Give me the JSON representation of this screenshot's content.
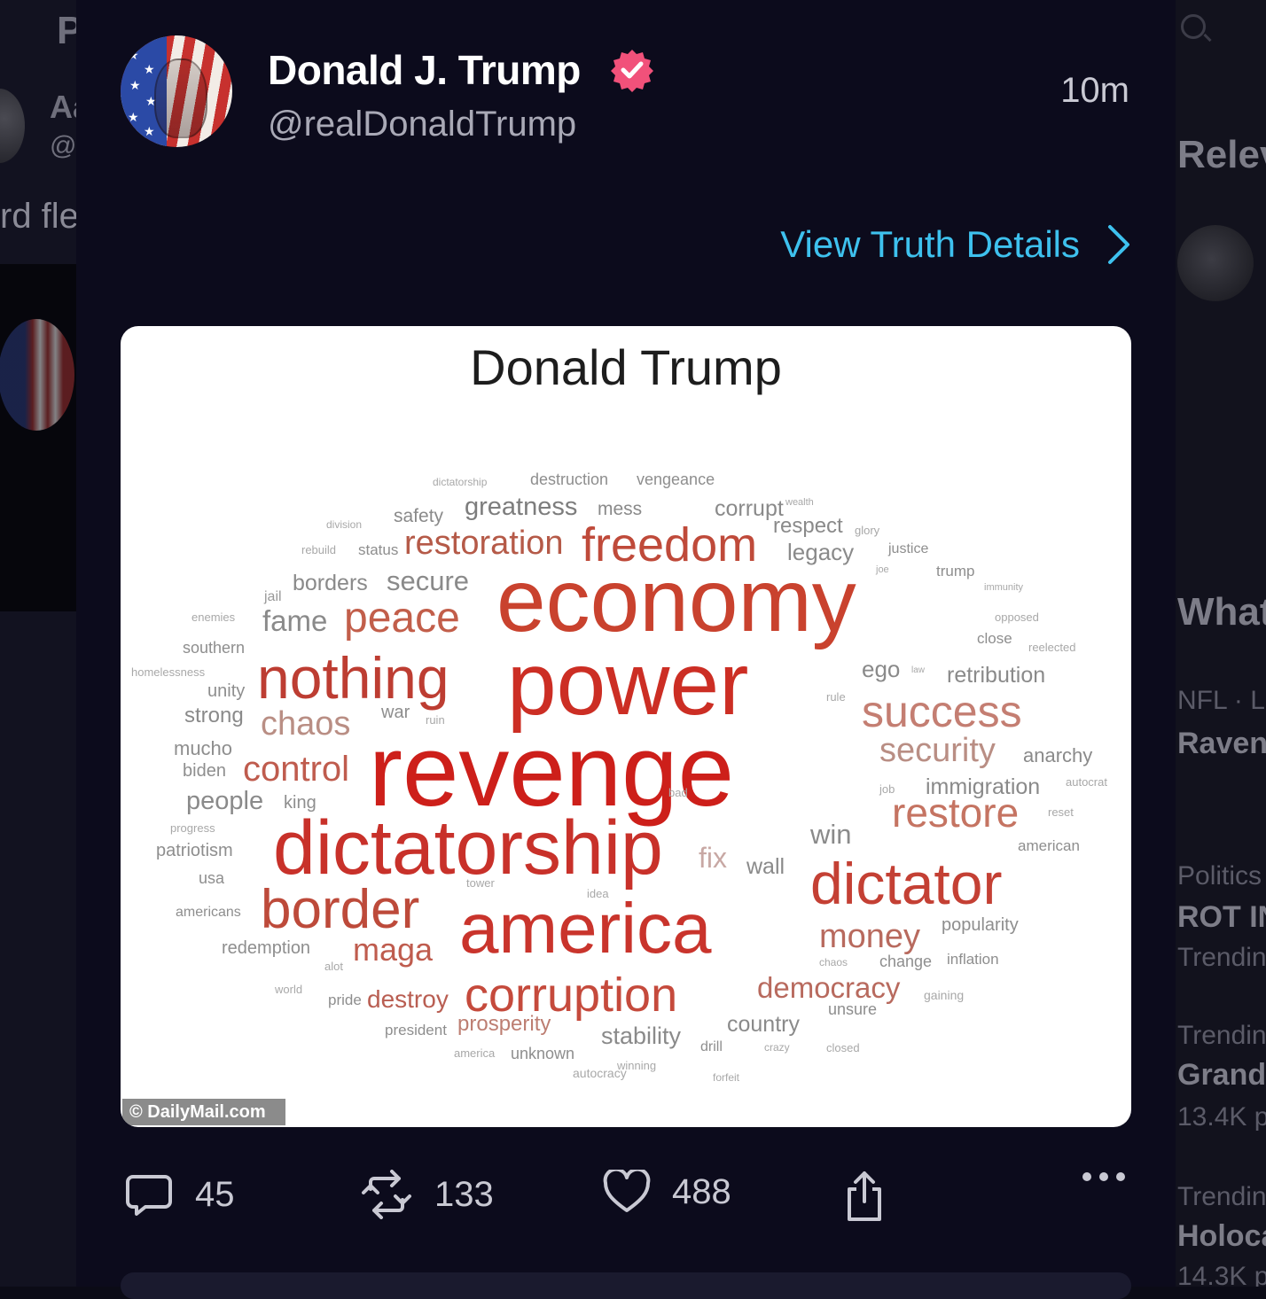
{
  "background_left": {
    "lines": [
      "P",
      "Aa",
      "@",
      "rd fle"
    ]
  },
  "background_right": {
    "items": [
      "Relev",
      "What",
      "NFL · La",
      "Raven",
      "Politics",
      "ROT IN",
      "Trendin",
      "Trendin",
      "Grand",
      "13.4K p",
      "Trendin",
      "Holoca",
      "14.3K p"
    ]
  },
  "post": {
    "author_name": "Donald J. Trump",
    "handle": "@realDonaldTrump",
    "time": "10m",
    "view_details_label": "View Truth Details",
    "verified_icon": "verified-badge-icon",
    "media": {
      "title": "Donald Trump",
      "watermark": "© DailyMail.com",
      "words": [
        "dictatorship",
        "destruction",
        "vengeance",
        "division",
        "safety",
        "greatness",
        "mess",
        "corrupt",
        "wealth",
        "respect",
        "glory",
        "rebuild",
        "status",
        "restoration",
        "freedom",
        "legacy",
        "justice",
        "joe",
        "trump",
        "jail",
        "borders",
        "secure",
        "immunity",
        "enemies",
        "fame",
        "peace",
        "economy",
        "opposed",
        "southern",
        "close",
        "reelected",
        "homelessness",
        "nothing",
        "power",
        "ego",
        "law",
        "retribution",
        "unity",
        "rule",
        "strong",
        "chaos",
        "war",
        "ruin",
        "success",
        "mucho",
        "security",
        "anarchy",
        "biden",
        "control",
        "revenge",
        "job",
        "immigration",
        "autocrat",
        "people",
        "king",
        "bad",
        "restore",
        "reset",
        "progress",
        "win",
        "american",
        "patriotism",
        "fix",
        "dictatorship",
        "usa",
        "tower",
        "wall",
        "dictator",
        "americans",
        "border",
        "idea",
        "america",
        "money",
        "popularity",
        "redemption",
        "maga",
        "chaos",
        "change",
        "inflation",
        "alot",
        "world",
        "pride",
        "destroy",
        "corruption",
        "democracy",
        "gaining",
        "unsure",
        "president",
        "prosperity",
        "stability",
        "country",
        "america",
        "unknown",
        "drill",
        "crazy",
        "closed",
        "autocracy",
        "winning",
        "forfeit"
      ]
    }
  },
  "actions": {
    "replies": "45",
    "reposts": "133",
    "likes": "488"
  },
  "colors": {
    "accent_link": "#3ec1ee",
    "verified": "#f1517a",
    "panel_bg": "#0c0b1c"
  }
}
